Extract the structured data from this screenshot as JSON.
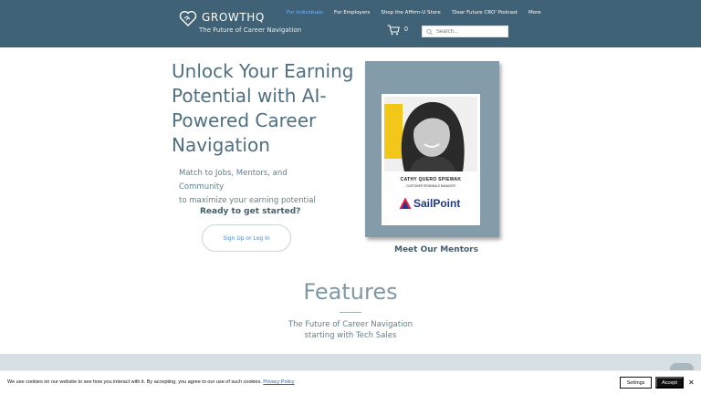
{
  "header": {
    "brand": "GROWTHQ",
    "tagline": "The Future of Career Navigation",
    "nav": [
      {
        "label": "For Individuals",
        "active": true
      },
      {
        "label": "For Employers",
        "active": false
      },
      {
        "label": "Shop the Affirm-U Store",
        "active": false
      },
      {
        "label": "'Dear Future CRO' Podcast",
        "active": false
      },
      {
        "label": "More",
        "active": false
      }
    ],
    "cart_count": "0",
    "search_placeholder": "Search..."
  },
  "hero": {
    "title": "Unlock Your Earning Potential with AI-Powered Career Navigation",
    "subtitle_line1": "Match to Jobs, Mentors, and Community",
    "subtitle_line2": "to maximize your earning potential",
    "ready": "Ready to get started?",
    "signup_label": "Sign Up or Log In"
  },
  "mentor": {
    "name": "CATHY QUERO SPIEWAK",
    "role": "CUSTOMER RENEWALS MANAGER",
    "sponsor": "SailPoint",
    "meet_label": "Meet Our Mentors"
  },
  "features": {
    "title": "Features",
    "sub_line1": "The Future of Career Navigation",
    "sub_line2": "starting with Tech Sales"
  },
  "cookie": {
    "text": "We use cookies on our website to see how you interact with it. By accepting, you agree to our use of such cookies.",
    "policy_link": "Privacy Policy",
    "settings_label": "Settings",
    "accept_label": "Accept",
    "close_label": "✕"
  },
  "colors": {
    "header_bg": "#3f6276",
    "accent": "#4e6f81",
    "card_bg": "#849caa",
    "active_nav": "#6fb6ff"
  }
}
